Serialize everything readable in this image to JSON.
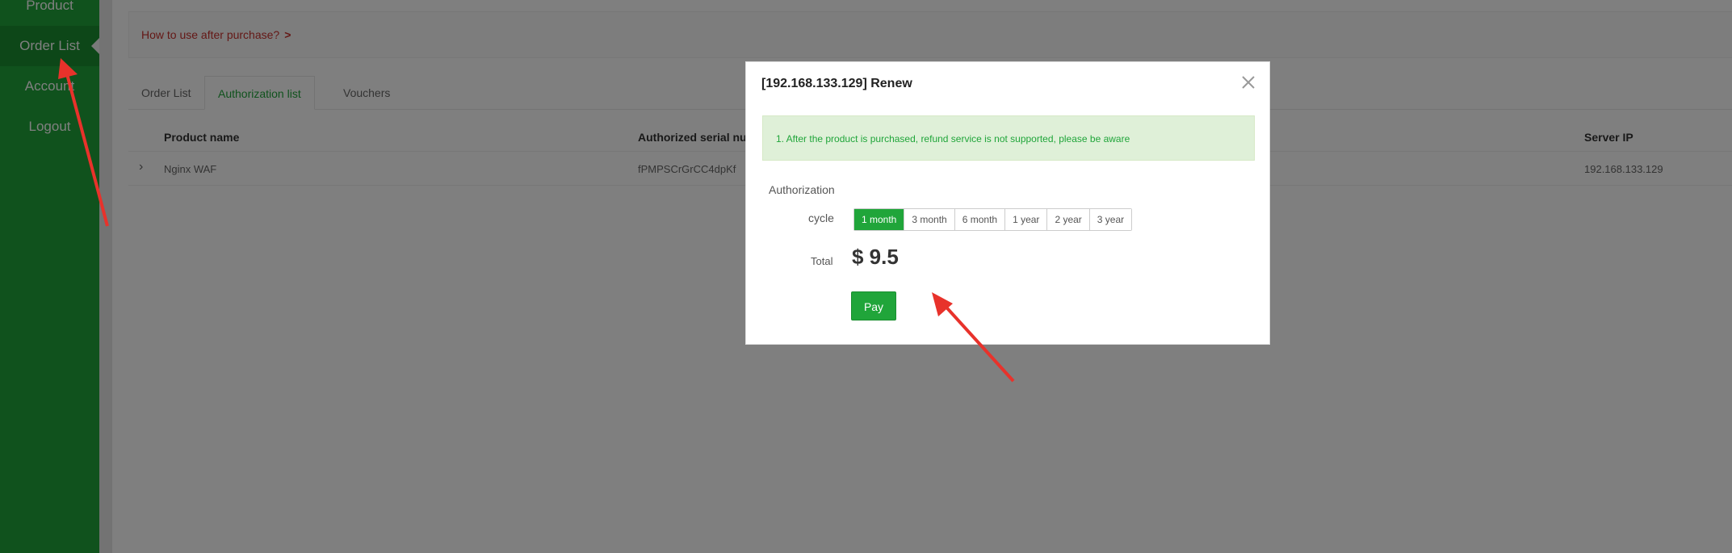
{
  "sidebar": {
    "items": [
      {
        "label": "Product"
      },
      {
        "label": "Order List"
      },
      {
        "label": "Account"
      },
      {
        "label": "Logout"
      }
    ]
  },
  "notice": {
    "link_text": "How to use after purchase?",
    "chevron": ">"
  },
  "tabs": [
    {
      "label": "Order List"
    },
    {
      "label": "Authorization list"
    },
    {
      "label": "Vouchers"
    }
  ],
  "table": {
    "headers": [
      "Product name",
      "Authorized serial nu",
      "Server IP"
    ],
    "rows": [
      {
        "expand": "›",
        "product": "Nginx WAF",
        "serial": "fPMPSCrGrCC4dpKf",
        "server_ip": "192.168.133.129"
      }
    ]
  },
  "modal": {
    "title": "[192.168.133.129] Renew",
    "close_icon": "close-icon",
    "alert": "1. After the product is purchased, refund service is not supported, please be aware",
    "authorization_label": "Authorization",
    "cycle_label": "cycle",
    "cycles": [
      "1 month",
      "3 month",
      "6 month",
      "1 year",
      "2 year",
      "3 year"
    ],
    "selected_cycle": "1 month",
    "total_label": "Total",
    "total_value": "$ 9.5",
    "pay_label": "Pay"
  },
  "colors": {
    "brand_green": "#20a53a",
    "annotation_arrow": "#e8322b"
  }
}
